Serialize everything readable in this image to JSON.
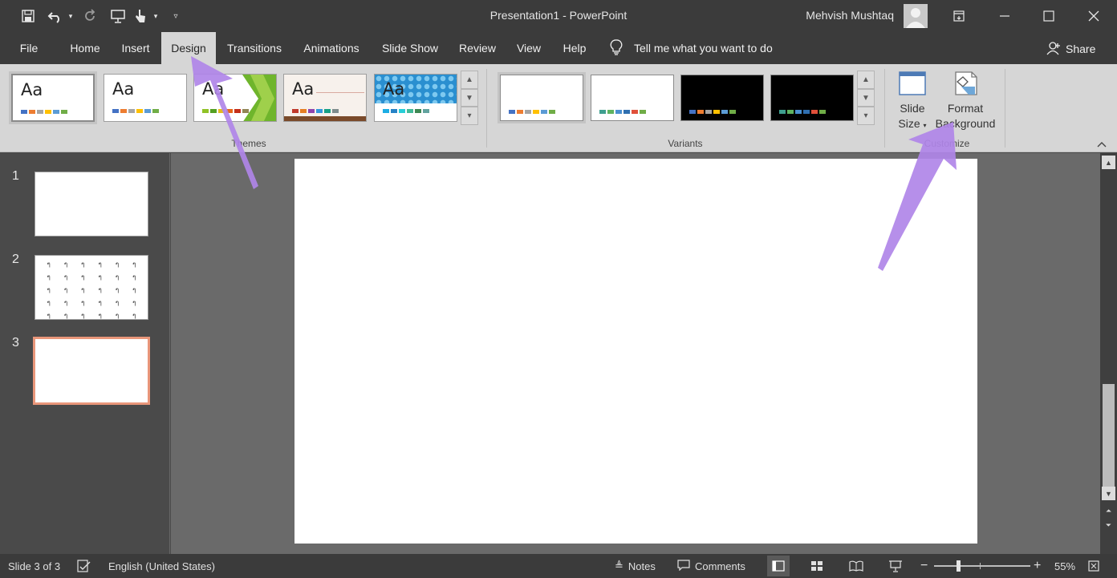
{
  "window": {
    "title": "Presentation1  -  PowerPoint",
    "user_name": "Mehvish Mushtaq"
  },
  "quick_access": {
    "icons": [
      "save-icon",
      "undo-icon",
      "redo-icon",
      "presenter-icon",
      "touch-mode-icon",
      "customize-qat-icon"
    ]
  },
  "tabs": [
    {
      "label": "File"
    },
    {
      "label": "Home"
    },
    {
      "label": "Insert"
    },
    {
      "label": "Design",
      "active": true
    },
    {
      "label": "Transitions"
    },
    {
      "label": "Animations"
    },
    {
      "label": "Slide Show"
    },
    {
      "label": "Review"
    },
    {
      "label": "View"
    },
    {
      "label": "Help"
    }
  ],
  "tell_me": {
    "label": "Tell me what you want to do"
  },
  "share": {
    "label": "Share"
  },
  "ribbon": {
    "themes": {
      "group_label": "Themes",
      "aa_label": "Aa",
      "items": [
        {
          "name": "office-theme-selected",
          "swatches": [
            "#4472c4",
            "#ed7d31",
            "#a5a5a5",
            "#ffc000",
            "#5b9bd5",
            "#70ad47"
          ]
        },
        {
          "name": "office-theme",
          "swatches": [
            "#4472c4",
            "#ed7d31",
            "#a5a5a5",
            "#ffc000",
            "#5b9bd5",
            "#70ad47"
          ]
        },
        {
          "name": "facet-theme",
          "swatches": [
            "#90c226",
            "#54a021",
            "#e6b91e",
            "#e76618",
            "#c42f1a",
            "#918655"
          ]
        },
        {
          "name": "integral-theme",
          "swatches": [
            "#c0392b",
            "#e67e22",
            "#8e44ad",
            "#3498db",
            "#16a085",
            "#7f8c8d"
          ]
        },
        {
          "name": "ion-theme",
          "swatches": [
            "#1cade4",
            "#2683c6",
            "#27ced7",
            "#42ba97",
            "#3e8853",
            "#62a39f"
          ]
        }
      ]
    },
    "variants": {
      "group_label": "Variants",
      "items": [
        {
          "bg": "#ffffff",
          "swatches": [
            "#4472c4",
            "#ed7d31",
            "#a5a5a5",
            "#ffc000",
            "#5b9bd5",
            "#70ad47"
          ]
        },
        {
          "bg": "#ffffff",
          "swatches": [
            "#3f9f8f",
            "#5fb35f",
            "#4a8fd0",
            "#2f6fb0",
            "#e0503a",
            "#70ad47"
          ]
        },
        {
          "bg": "#000000",
          "swatches": [
            "#4472c4",
            "#ed7d31",
            "#a5a5a5",
            "#ffc000",
            "#5b9bd5",
            "#70ad47"
          ]
        },
        {
          "bg": "#000000",
          "swatches": [
            "#3f9f8f",
            "#5fb35f",
            "#4a8fd0",
            "#2f6fb0",
            "#e0503a",
            "#70ad47"
          ]
        }
      ]
    },
    "customize": {
      "group_label": "Customize",
      "slide_size": {
        "line1": "Slide",
        "line2": "Size"
      },
      "format_background": {
        "line1": "Format",
        "line2": "Background"
      }
    }
  },
  "slides": [
    {
      "num": "1",
      "pattern": false
    },
    {
      "num": "2",
      "pattern": true,
      "glyph": "ๆ"
    },
    {
      "num": "3",
      "pattern": false,
      "selected": true
    }
  ],
  "statusbar": {
    "slide_info": "Slide 3 of 3",
    "language": "English (United States)",
    "notes": "Notes",
    "comments": "Comments",
    "zoom": "55%"
  },
  "colors": {
    "accent_arrow": "#b085e8",
    "selected_slide_border": "#e9967a"
  }
}
